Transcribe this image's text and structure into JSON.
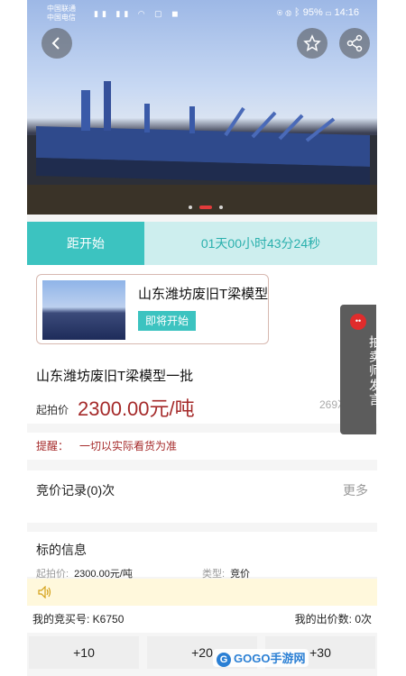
{
  "status_bar": {
    "carrier1": "中国联通",
    "carrier2": "中国电信",
    "battery": "95%",
    "time": "14:16"
  },
  "hero": {
    "back_icon": "back-arrow-icon",
    "favorite_icon": "star-icon",
    "share_icon": "share-icon",
    "carousel_count": 3,
    "carousel_active": 1
  },
  "countdown": {
    "label": "距开始",
    "time": "01天00小时43分24秒"
  },
  "card": {
    "title": "山东潍坊废旧T梁模型",
    "badge": "即将开始"
  },
  "seller_tab": {
    "label": "拍卖师发言",
    "icon": "chat-bubble-icon"
  },
  "lot": {
    "title": "山东潍坊废旧T梁模型一批",
    "price_label": "起拍价",
    "price": "2300.00元/吨",
    "views": "269次围观"
  },
  "reminder": {
    "label": "提醒：",
    "text": "一切以实际看货为准"
  },
  "records": {
    "title": "竞价记录(0)次",
    "more": "更多"
  },
  "info": {
    "title": "标的信息",
    "start_price_label": "起拍价:",
    "start_price_value": "2300.00元/吨",
    "type_label": "类型:",
    "type_value": "竞价"
  },
  "notice": {
    "icon": "speaker-icon"
  },
  "numbers": {
    "my_bid_no": "我的竞买号:  K6750",
    "my_bid_count": "我的出价数:  0次"
  },
  "bid_buttons": [
    "+10",
    "+20",
    "+30"
  ],
  "watermark": {
    "text": "GOGO手游网"
  },
  "colors": {
    "accent": "#3cc3c0",
    "accent_light": "#cdeeee",
    "price": "#a52a2a",
    "seller_tab": "#5c5c5c",
    "notice_bg": "#fff8dc"
  }
}
